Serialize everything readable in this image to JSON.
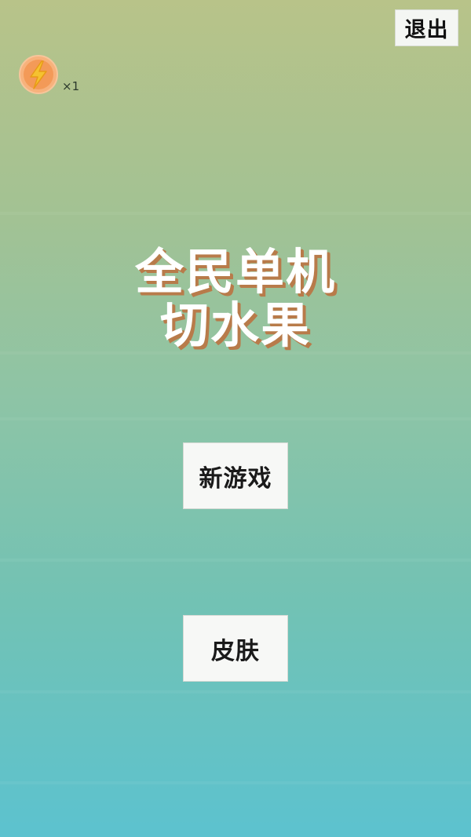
{
  "header": {
    "exit_label": "退出"
  },
  "powerup": {
    "icon": "lightning-bolt-icon",
    "count_text": "×1",
    "color": "#f5a623"
  },
  "title": {
    "line1": "全民单机",
    "line2": "切水果",
    "text_color": "#ffffff",
    "shadow_color": "#b87b4a"
  },
  "menu": {
    "new_game_label": "新游戏",
    "skin_label": "皮肤"
  },
  "background": {
    "top_color": "#b8c389",
    "bottom_color": "#5cc2cf"
  }
}
